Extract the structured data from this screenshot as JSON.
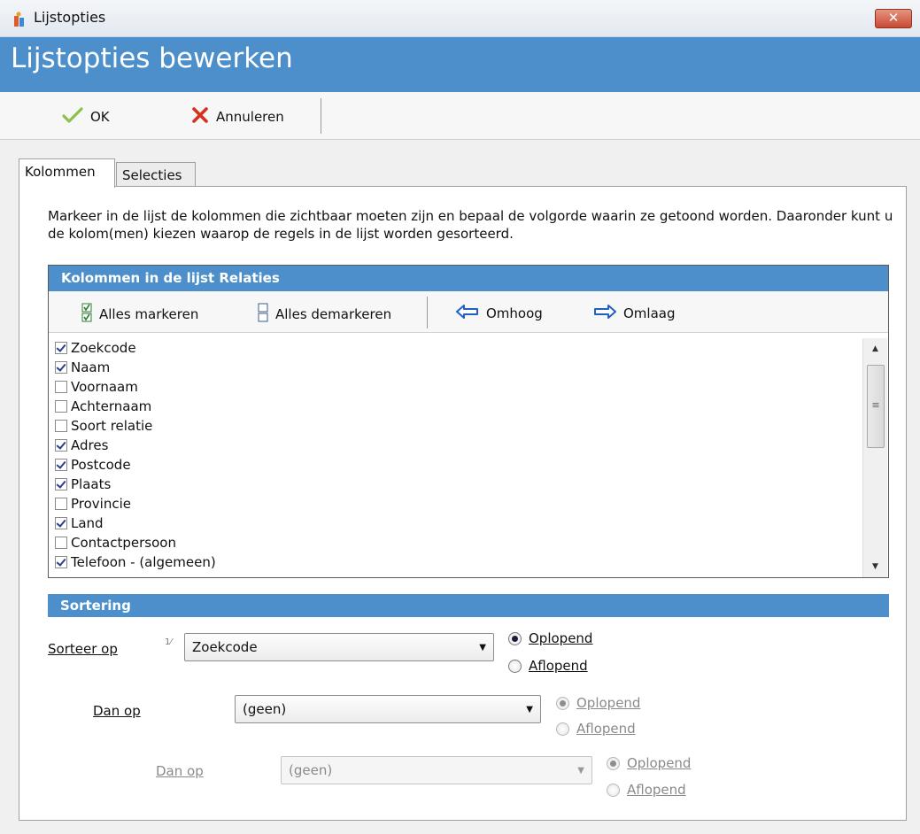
{
  "window": {
    "title": "Lijstopties",
    "close_label": "✕"
  },
  "header": {
    "title": "Lijstopties bewerken"
  },
  "toolbar": {
    "ok_label": "OK",
    "cancel_label": "Annuleren"
  },
  "tabs": [
    {
      "label": "Kolommen",
      "active": true
    },
    {
      "label": "Selecties",
      "active": false
    }
  ],
  "description": "Markeer in de lijst de kolommen die zichtbaar moeten zijn en bepaal de volgorde waarin ze getoond worden. Daaronder kunt u de kolom(men) kiezen waarop de regels in de lijst worden gesorteerd.",
  "columns_panel": {
    "title": "Kolommen in de lijst Relaties",
    "mark_all_label": "Alles markeren",
    "unmark_all_label": "Alles demarkeren",
    "up_label": "Omhoog",
    "down_label": "Omlaag",
    "items": [
      {
        "label": "Zoekcode",
        "checked": true
      },
      {
        "label": "Naam",
        "checked": true
      },
      {
        "label": "Voornaam",
        "checked": false
      },
      {
        "label": "Achternaam",
        "checked": false
      },
      {
        "label": "Soort relatie",
        "checked": false
      },
      {
        "label": "Adres",
        "checked": true
      },
      {
        "label": "Postcode",
        "checked": true
      },
      {
        "label": "Plaats",
        "checked": true
      },
      {
        "label": "Provincie",
        "checked": false
      },
      {
        "label": "Land",
        "checked": true
      },
      {
        "label": "Contactpersoon",
        "checked": false
      },
      {
        "label": "Telefoon - (algemeen)",
        "checked": true
      }
    ]
  },
  "sort_panel": {
    "title": "Sortering",
    "sort1": {
      "label": "Sorteer op",
      "order_marker": "1⁄",
      "value": "Zoekcode",
      "asc_label": "Oplopend",
      "desc_label": "Aflopend",
      "selected": "asc"
    },
    "sort2": {
      "label": "Dan op",
      "value": "(geen)",
      "asc_label": "Oplopend",
      "desc_label": "Aflopend",
      "selected": "asc"
    },
    "sort3": {
      "label": "Dan op",
      "value": "(geen)",
      "asc_label": "Oplopend",
      "desc_label": "Aflopend",
      "selected": "asc"
    }
  },
  "colors": {
    "accent": "#4c8fcb",
    "close": "#c94a34"
  }
}
